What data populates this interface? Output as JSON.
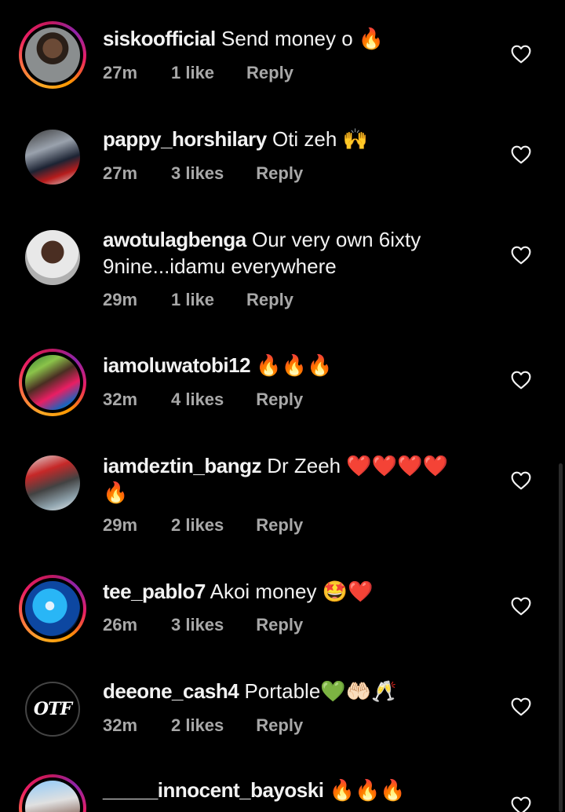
{
  "comments": [
    {
      "username": "siskoofficial",
      "text": "Send money o 🔥",
      "time": "27m",
      "likes": "1 like",
      "reply": "Reply"
    },
    {
      "username": "pappy_horshilary",
      "text": "Oti zeh 🙌",
      "time": "27m",
      "likes": "3 likes",
      "reply": "Reply"
    },
    {
      "username": "awotulagbenga",
      "text": "Our very own 6ixty 9nine...idamu everywhere",
      "time": "29m",
      "likes": "1 like",
      "reply": "Reply"
    },
    {
      "username": "iamoluwatobi12",
      "text": "🔥🔥🔥",
      "time": "32m",
      "likes": "4 likes",
      "reply": "Reply"
    },
    {
      "username": "iamdeztin_bangz",
      "text": "Dr Zeeh ❤️❤️❤️❤️🔥",
      "time": "29m",
      "likes": "2 likes",
      "reply": "Reply"
    },
    {
      "username": "tee_pablo7",
      "text": "Akoi money 🤩❤️",
      "time": "26m",
      "likes": "3 likes",
      "reply": "Reply"
    },
    {
      "username": "deeone_cash4",
      "text": "Portable💚🤲🏻🥂",
      "time": "32m",
      "likes": "2 likes",
      "reply": "Reply"
    },
    {
      "username": "_____innocent_bayoski",
      "text": "🔥🔥🔥"
    }
  ],
  "avatars": {
    "deeone_cash4_logo": "OTF"
  },
  "icons": {
    "like": "heart-outline-icon"
  },
  "colors": {
    "background": "#000000",
    "text": "#f2f2f2",
    "meta": "#a8a8a8",
    "story_ring": "#e91e63"
  }
}
